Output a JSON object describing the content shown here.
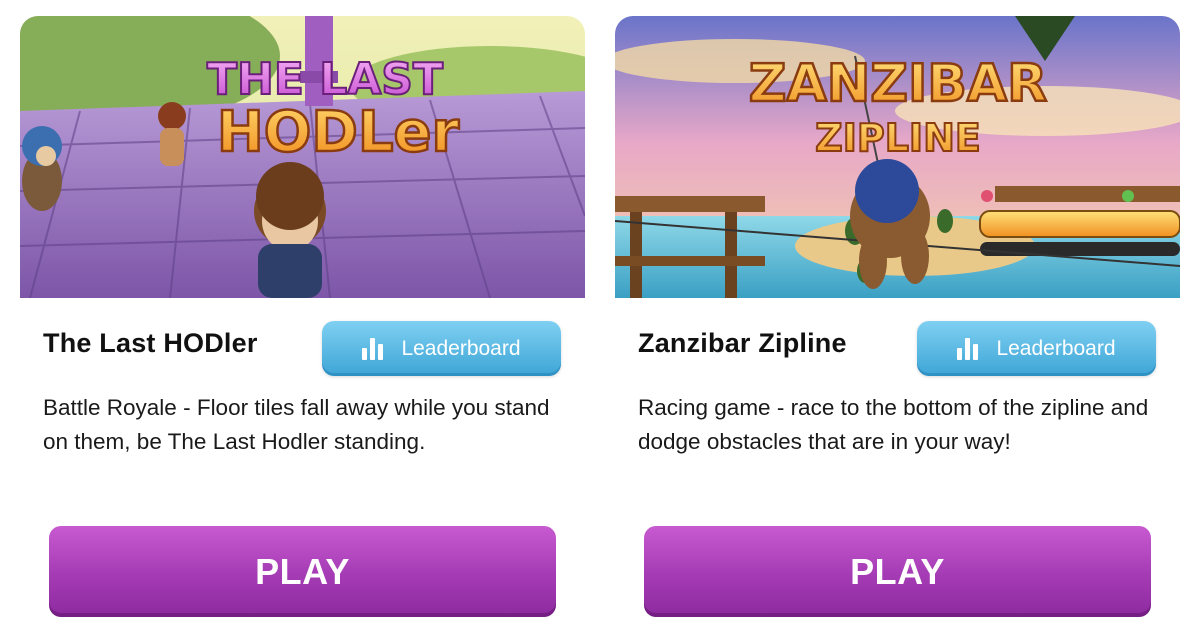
{
  "games": [
    {
      "title": "The Last HODler",
      "thumbnail_text": [
        "THE LAST",
        "HODLer"
      ],
      "leaderboard_label": "Leaderboard",
      "leaderboard_icon": "bar-chart-icon",
      "description": "Battle Royale - Floor tiles fall away while you stand on them, be The Last Hodler standing.",
      "play_label": "PLAY"
    },
    {
      "title": "Zanzibar Zipline",
      "thumbnail_text": [
        "ZANZIBAR",
        "ZIPLINE"
      ],
      "leaderboard_label": "Leaderboard",
      "leaderboard_icon": "bar-chart-icon",
      "description": "Racing game - race to the bottom of the zipline and dodge obstacles that are in your way!",
      "play_label": "PLAY"
    }
  ],
  "colors": {
    "leaderboard_button": "#4fb5e2",
    "play_button": "#a43bb4",
    "text": "#111111"
  }
}
